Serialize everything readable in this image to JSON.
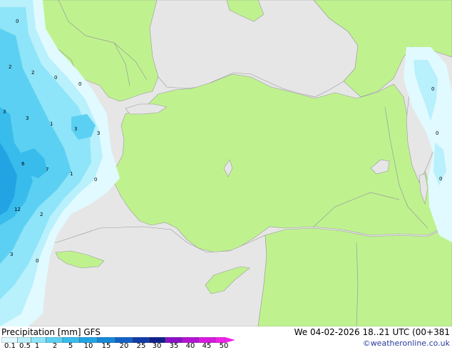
{
  "footer": {
    "title": "Precipitation [mm]  GFS",
    "datetime": "We 04-02-2026 18..21 UTC (00+381",
    "credit": "©weatheronline.co.uk"
  },
  "legend": {
    "ticks": [
      "0.1",
      "0.5",
      "1",
      "2",
      "5",
      "10",
      "15",
      "20",
      "25",
      "30",
      "35",
      "40",
      "45",
      "50"
    ],
    "colors": [
      "#e0faff",
      "#b8f0fc",
      "#8ee4f8",
      "#5cd0f2",
      "#38bcec",
      "#22a4e4",
      "#1688d8",
      "#1262c6",
      "#103ca8",
      "#10208a",
      "#8a10c8",
      "#b414d4",
      "#d81ae0",
      "#f022e8"
    ]
  },
  "map": {
    "colors": {
      "land": "#bff28f",
      "sea": "#e6e6e6",
      "border": "#9a9a9a"
    },
    "labels": [
      "0",
      "2",
      "2",
      "0",
      "0",
      "3",
      "3",
      "1",
      "3",
      "3",
      "6",
      "7",
      "1",
      "0",
      "12",
      "2",
      "3",
      "0",
      "0",
      "0",
      "0"
    ]
  }
}
